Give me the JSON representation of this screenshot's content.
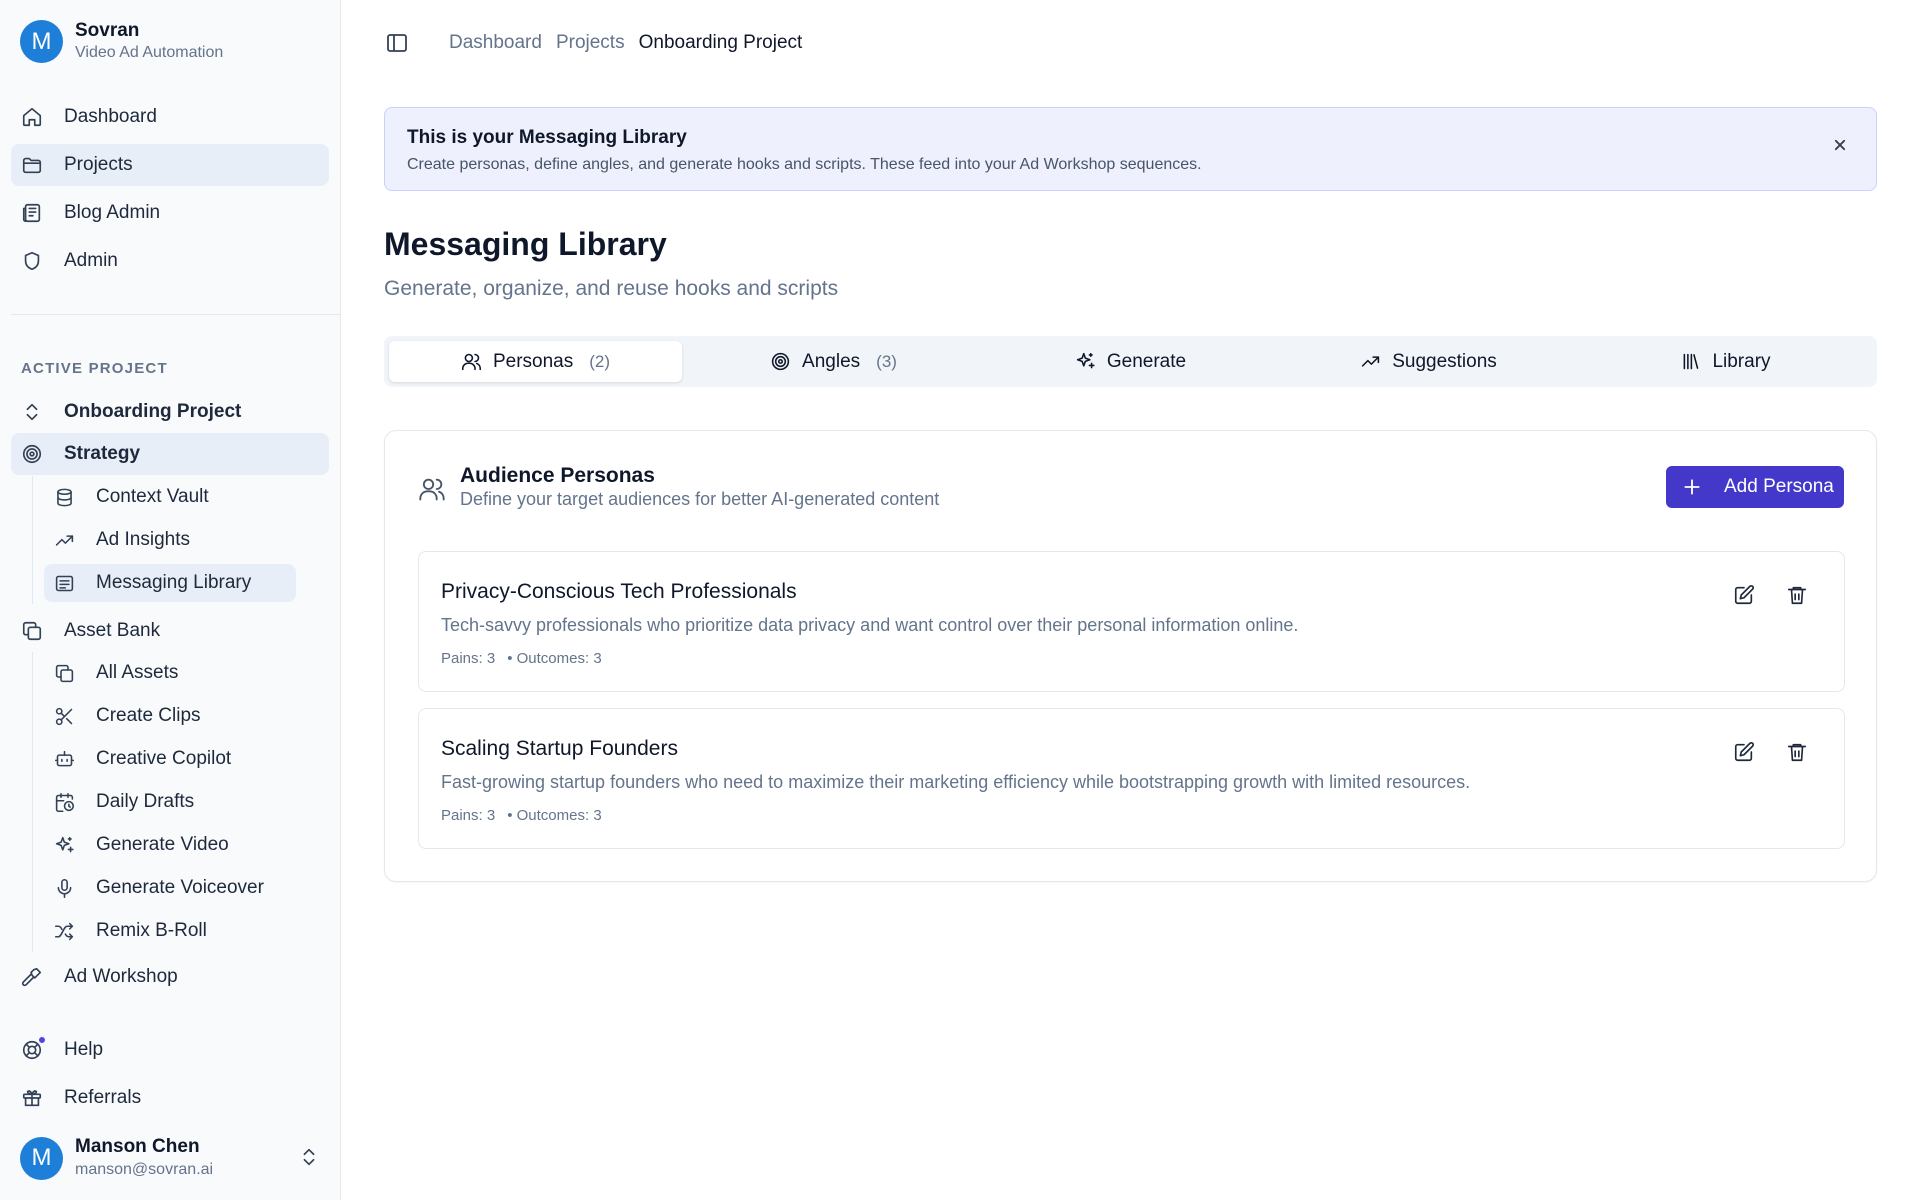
{
  "brand": {
    "initial": "M",
    "name": "Sovran",
    "subtitle": "Video Ad Automation"
  },
  "nav": [
    {
      "label": "Dashboard",
      "icon": "home-icon"
    },
    {
      "label": "Projects",
      "icon": "folder-icon",
      "active": true
    },
    {
      "label": "Blog Admin",
      "icon": "newspaper-icon"
    },
    {
      "label": "Admin",
      "icon": "shield-icon"
    }
  ],
  "active_project": {
    "section_label": "ACTIVE PROJECT",
    "project_name": "Onboarding Project",
    "strategy": "Strategy",
    "strategy_items": [
      "Context Vault",
      "Ad Insights",
      "Messaging Library"
    ],
    "asset_bank": "Asset Bank",
    "asset_items": [
      "All Assets",
      "Create Clips",
      "Creative Copilot",
      "Daily Drafts",
      "Generate Video",
      "Generate Voiceover",
      "Remix B-Roll"
    ],
    "ad_workshop": "Ad Workshop"
  },
  "footer_nav": [
    {
      "label": "Help",
      "icon": "help-circle-icon"
    },
    {
      "label": "Referrals",
      "icon": "gift-icon"
    }
  ],
  "user": {
    "initial": "M",
    "name": "Manson Chen",
    "email": "manson@sovran.ai"
  },
  "breadcrumb": [
    "Dashboard",
    "Projects",
    "Onboarding Project"
  ],
  "banner": {
    "title": "This is your Messaging Library",
    "description": "Create personas, define angles, and generate hooks and scripts. These feed into your Ad Workshop sequences."
  },
  "page": {
    "title": "Messaging Library",
    "subtitle": "Generate, organize, and reuse hooks and scripts"
  },
  "tabs": [
    {
      "label": "Personas",
      "count": "(2)",
      "icon": "users-icon",
      "active": true
    },
    {
      "label": "Angles",
      "count": "(3)",
      "icon": "target-icon"
    },
    {
      "label": "Generate",
      "count": "",
      "icon": "sparkles-icon"
    },
    {
      "label": "Suggestions",
      "count": "",
      "icon": "trending-up-icon"
    },
    {
      "label": "Library",
      "count": "",
      "icon": "library-icon"
    }
  ],
  "personas_panel": {
    "title": "Audience Personas",
    "subtitle": "Define your target audiences for better AI-generated content",
    "add_button": "Add Persona",
    "items": [
      {
        "title": "Privacy-Conscious Tech Professionals",
        "description": "Tech-savvy professionals who prioritize data privacy and want control over their personal information online.",
        "pains": "Pains: 3",
        "outcomes": "• Outcomes: 3"
      },
      {
        "title": "Scaling Startup Founders",
        "description": "Fast-growing startup founders who need to maximize their marketing efficiency while bootstrapping growth with limited resources.",
        "pains": "Pains: 3",
        "outcomes": "• Outcomes: 3"
      }
    ]
  },
  "colors": {
    "accent": "#4338ca",
    "active_bg": "#e8eef8",
    "banner_bg": "#eef1fd",
    "avatar": "#1d7fd8"
  }
}
